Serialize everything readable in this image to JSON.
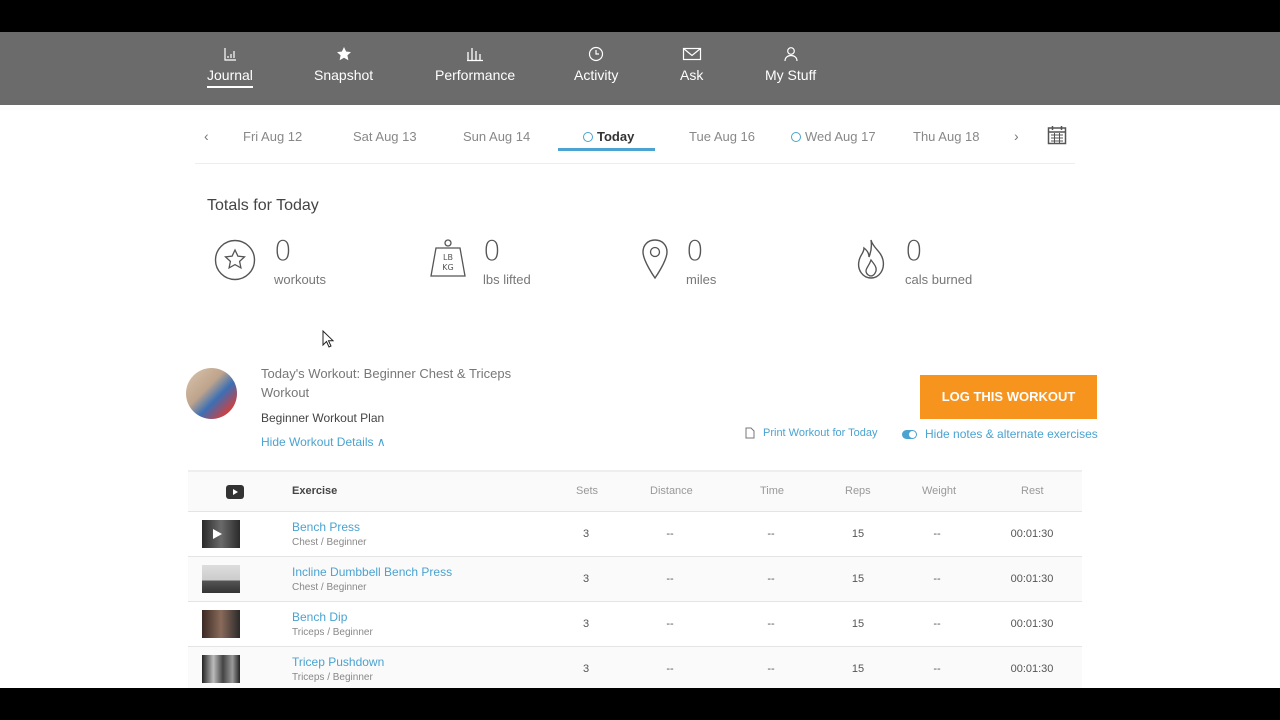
{
  "nav": {
    "items": [
      {
        "label": "Journal",
        "icon": "journal-icon"
      },
      {
        "label": "Snapshot",
        "icon": "star-icon"
      },
      {
        "label": "Performance",
        "icon": "bar-chart-icon"
      },
      {
        "label": "Activity",
        "icon": "clock-icon"
      },
      {
        "label": "Ask",
        "icon": "mail-icon"
      },
      {
        "label": "My Stuff",
        "icon": "user-icon"
      }
    ]
  },
  "datebar": {
    "dates": [
      "Fri Aug 12",
      "Sat Aug 13",
      "Sun Aug 14",
      "Today",
      "Tue Aug 16",
      "Wed Aug 17",
      "Thu Aug 18"
    ],
    "prev": "‹",
    "next": "›"
  },
  "totals": {
    "title": "Totals for Today",
    "stats": [
      {
        "value": "0",
        "label": "workouts",
        "icon": "star-circle-icon"
      },
      {
        "value": "0",
        "label": "lbs lifted",
        "icon": "weight-icon"
      },
      {
        "value": "0",
        "label": "miles",
        "icon": "location-pin-icon"
      },
      {
        "value": "0",
        "label": "cals burned",
        "icon": "flame-icon"
      }
    ]
  },
  "workout": {
    "title": "Today's Workout: Beginner Chest & Triceps Workout",
    "plan": "Beginner Workout Plan",
    "hide_details": "Hide Workout Details ∧",
    "log_button": "LOG THIS WORKOUT",
    "print_link": "Print Workout for Today",
    "toggle_label": "Hide notes & alternate exercises"
  },
  "table": {
    "headers": {
      "exercise": "Exercise",
      "sets": "Sets",
      "distance": "Distance",
      "time": "Time",
      "reps": "Reps",
      "weight": "Weight",
      "rest": "Rest"
    },
    "rows": [
      {
        "name": "Bench Press",
        "sub": "Chest / Beginner",
        "sets": "3",
        "distance": "--",
        "time": "--",
        "reps": "15",
        "weight": "--",
        "rest": "00:01:30"
      },
      {
        "name": "Incline Dumbbell Bench Press",
        "sub": "Chest / Beginner",
        "sets": "3",
        "distance": "--",
        "time": "--",
        "reps": "15",
        "weight": "--",
        "rest": "00:01:30"
      },
      {
        "name": "Bench Dip",
        "sub": "Triceps / Beginner",
        "sets": "3",
        "distance": "--",
        "time": "--",
        "reps": "15",
        "weight": "--",
        "rest": "00:01:30"
      },
      {
        "name": "Tricep Pushdown",
        "sub": "Triceps / Beginner",
        "sets": "3",
        "distance": "--",
        "time": "--",
        "reps": "15",
        "weight": "--",
        "rest": "00:01:30"
      }
    ]
  },
  "colors": {
    "nav_bg": "#6b6b6b",
    "accent_blue": "#4aa3d1",
    "cta_orange": "#f7941e"
  }
}
